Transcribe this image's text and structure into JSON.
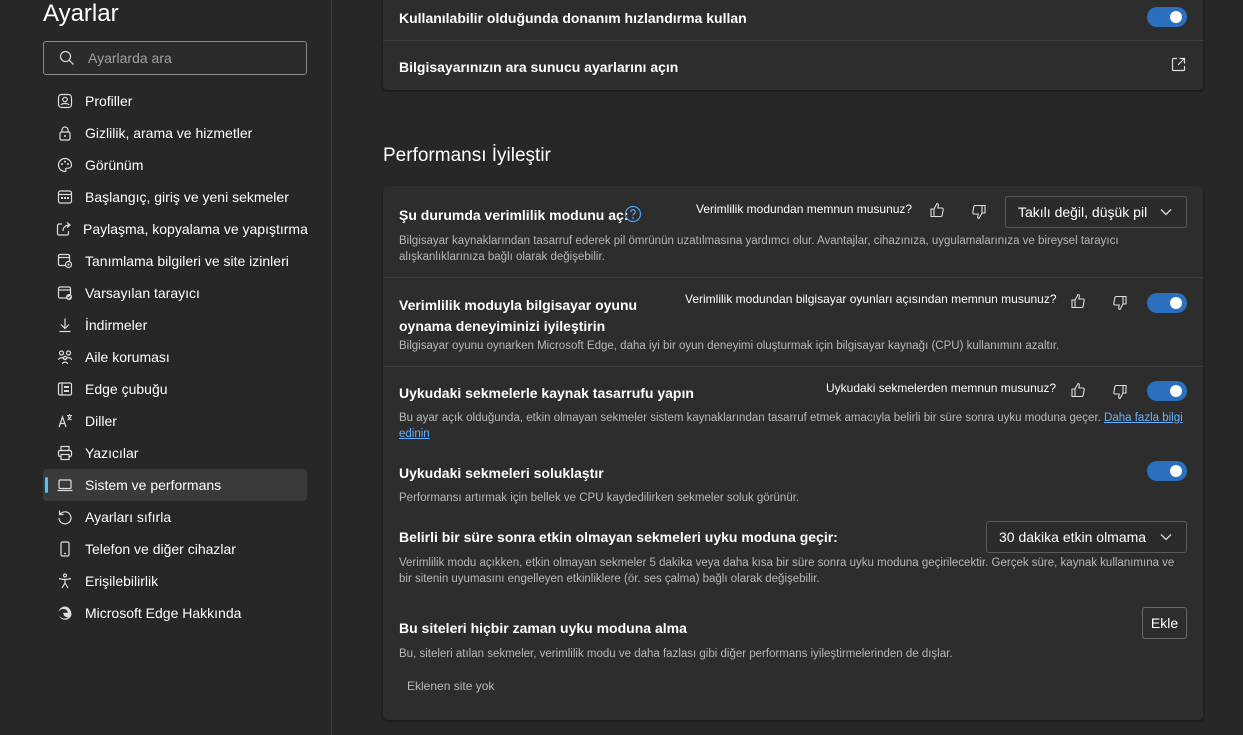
{
  "sidebar": {
    "title": "Ayarlar",
    "search_placeholder": "Ayarlarda ara",
    "items": [
      {
        "label": "Profiller",
        "icon": "profile-icon"
      },
      {
        "label": "Gizlilik, arama ve hizmetler",
        "icon": "lock-icon"
      },
      {
        "label": "Görünüm",
        "icon": "palette-icon"
      },
      {
        "label": "Başlangıç, giriş ve yeni sekmeler",
        "icon": "window-icon"
      },
      {
        "label": "Paylaşma, kopyalama ve yapıştırma",
        "icon": "share-icon"
      },
      {
        "label": "Tanımlama bilgileri ve site izinleri",
        "icon": "site-permissions-icon"
      },
      {
        "label": "Varsayılan tarayıcı",
        "icon": "default-browser-icon"
      },
      {
        "label": "İndirmeler",
        "icon": "download-icon"
      },
      {
        "label": "Aile koruması",
        "icon": "family-icon"
      },
      {
        "label": "Edge çubuğu",
        "icon": "edge-bar-icon"
      },
      {
        "label": "Diller",
        "icon": "language-icon"
      },
      {
        "label": "Yazıcılar",
        "icon": "printer-icon"
      },
      {
        "label": "Sistem ve performans",
        "icon": "laptop-icon",
        "active": true
      },
      {
        "label": "Ayarları sıfırla",
        "icon": "reset-icon"
      },
      {
        "label": "Telefon ve diğer cihazlar",
        "icon": "phone-icon"
      },
      {
        "label": "Erişilebilirlik",
        "icon": "accessibility-icon"
      },
      {
        "label": "Microsoft Edge Hakkında",
        "icon": "edge-logo-icon"
      }
    ]
  },
  "top_card": {
    "hw_accel_label": "Kullanılabilir olduğunda donanım hızlandırma kullan",
    "hw_accel_on": true,
    "proxy_label": "Bilgisayarınızın ara sunucu ayarlarını açın"
  },
  "performance": {
    "section_title": "Performansı İyileştir",
    "efficiency": {
      "title": "Şu durumda verimlilik modunu aç:",
      "feedback_question": "Verimlilik modundan memnun musunuz?",
      "dropdown_value": "Takılı değil, düşük pil",
      "description": "Bilgisayar kaynaklarından tasarruf ederek pil ömrünün uzatılmasına yardımcı olur. Avantajlar, cihazınıza, uygulamalarınıza ve bireysel tarayıcı alışkanlıklarınıza bağlı olarak değişebilir."
    },
    "gaming": {
      "title_line1": "Verimlilik moduyla bilgisayar oyunu",
      "title_line2": "oynama deneyiminizi iyileştirin",
      "feedback_question": "Verimlilik modundan bilgisayar oyunları açısından memnun musunuz?",
      "on": true,
      "description": "Bilgisayar oyunu oynarken Microsoft Edge, daha iyi bir oyun deneyimi oluşturmak için bilgisayar kaynağı (CPU) kullanımını azaltır."
    },
    "sleeping_tabs": {
      "title": "Uykudaki sekmelerle kaynak tasarrufu yapın",
      "feedback_question": "Uykudaki sekmelerden memnun musunuz?",
      "on": true,
      "description": "Bu ayar açık olduğunda, etkin olmayan sekmeler sistem kaynaklarından tasarruf etmek amacıyla belirli bir süre sonra uyku moduna geçer. ",
      "link_text": "Daha fazla bilgi edinin"
    },
    "fade_tabs": {
      "title": "Uykudaki sekmeleri soluklaştır",
      "on": true,
      "description": "Performansı artırmak için bellek ve CPU kaydedilirken sekmeler soluk görünür."
    },
    "sleep_after": {
      "title": "Belirli bir süre sonra etkin olmayan sekmeleri uyku moduna geçir:",
      "dropdown_value": "30 dakika etkin olmama",
      "description": "Verimlilik modu açıkken, etkin olmayan sekmeler 5 dakika veya daha kısa bir süre sonra uyku moduna geçirilecektir. Gerçek süre, kaynak kullanımına ve bir sitenin uyumasını engelleyen etkinliklere (ör. ses çalma) bağlı olarak değişebilir."
    },
    "never_sleep": {
      "title": "Bu siteleri hiçbir zaman uyku moduna alma",
      "add_button": "Ekle",
      "description": "Bu, siteleri atılan sekmeler, verimlilik modu ve daha fazlası gibi diğer performans iyileştirmelerinden de dışlar.",
      "empty_text": "Eklenen site yok"
    }
  },
  "colors": {
    "accent": "#2b6fbf",
    "link": "#6ab0ff",
    "background": "#272727",
    "card": "#2d2d2d"
  }
}
